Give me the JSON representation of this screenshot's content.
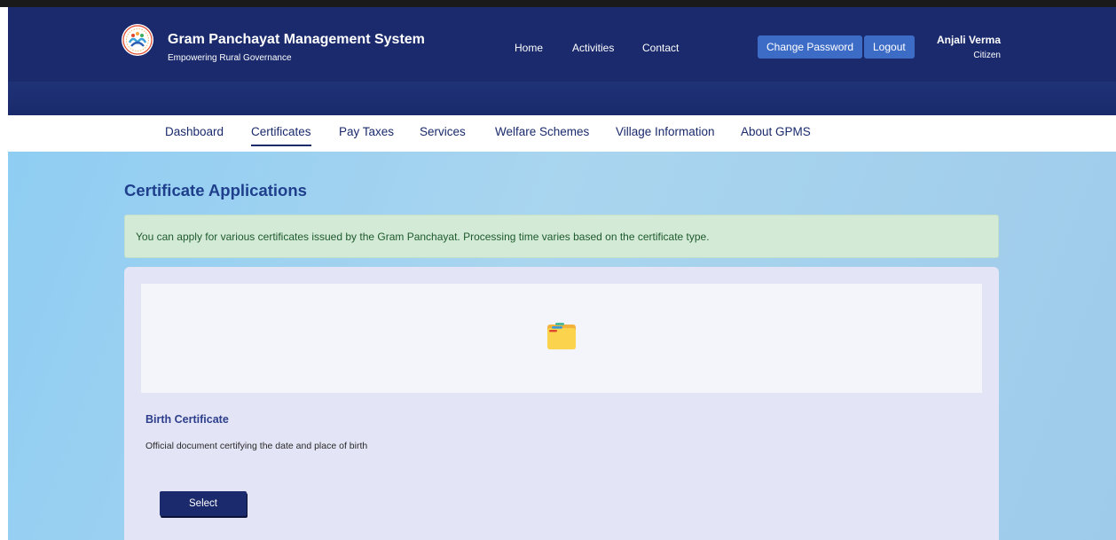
{
  "brand": {
    "title": "Gram Panchayat Management System",
    "subtitle": "Empowering Rural Governance",
    "logo_icon": "panchayat-logo"
  },
  "topnav": {
    "items": [
      {
        "label": "Home"
      },
      {
        "label": "Activities"
      },
      {
        "label": "Contact"
      }
    ],
    "change_password_label": "Change Password",
    "logout_label": "Logout"
  },
  "user": {
    "name": "Anjali Verma",
    "role": "Citizen"
  },
  "subnav": {
    "items": [
      {
        "label": "Dashboard",
        "active": false
      },
      {
        "label": "Certificates",
        "active": true
      },
      {
        "label": "Pay Taxes",
        "active": false
      },
      {
        "label": "Services",
        "active": false
      },
      {
        "label": "Welfare Schemes",
        "active": false
      },
      {
        "label": "Village Information",
        "active": false
      },
      {
        "label": "About GPMS",
        "active": false
      }
    ]
  },
  "main": {
    "title": "Certificate Applications",
    "info_text": "You can apply for various certificates issued by the Gram Panchayat. Processing time varies based on the certificate type.",
    "cards": [
      {
        "icon": "folder-icon",
        "title": "Birth Certificate",
        "description": "Official document certifying the date and place of birth",
        "button_label": "Select"
      }
    ]
  },
  "colors": {
    "header": "#1a2a6c",
    "primary_button": "#3d6cc7",
    "title": "#1f3f8c",
    "alert_bg": "#d3ead7",
    "alert_text": "#1e5a2c",
    "panel_bg": "#e3e4f5"
  }
}
